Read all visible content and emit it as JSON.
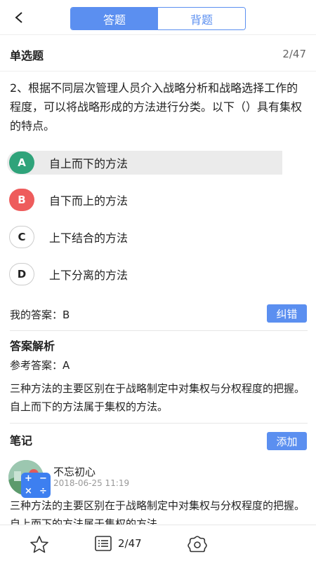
{
  "header": {
    "back_icon": "chevron-left-icon",
    "tabs": [
      {
        "label": "答题",
        "active": true
      },
      {
        "label": "背题",
        "active": false
      }
    ],
    "accent_color": "#5b8ff0"
  },
  "question_type": {
    "title": "单选题",
    "progress": "2/47"
  },
  "question": {
    "text": "2、根据不同层次管理人员介入战略分析和战略选择工作的程度，可以将战略形成的方法进行分类。以下（）具有集权的特点。"
  },
  "options": [
    {
      "letter": "A",
      "text": "自上而下的方法",
      "state": "correct"
    },
    {
      "letter": "B",
      "text": "自下而上的方法",
      "state": "wrong"
    },
    {
      "letter": "C",
      "text": "上下结合的方法",
      "state": "plain"
    },
    {
      "letter": "D",
      "text": "上下分离的方法",
      "state": "plain"
    }
  ],
  "my_answer": {
    "text": "我的答案：B",
    "report_button": "纠错"
  },
  "analysis": {
    "title": "答案解析",
    "reference": "参考答案：A",
    "explanation": "三种方法的主要区别在于战略制定中对集权与分权程度的把握。自上而下的方法属于集权的方法。"
  },
  "notes": {
    "title": "笔记",
    "add_button": "添加",
    "item": {
      "author": "不忘初心",
      "time": "2018-06-25 11:19",
      "content": "三种方法的主要区别在于战略制定中对集权与分权程度的把握。自上而下的方法属于集权的方法。"
    },
    "calculator_glyphs": [
      "+",
      "−",
      "×",
      "÷"
    ]
  },
  "bottom_bar": {
    "favorite_icon": "star-icon",
    "list_icon": "answer-sheet-icon",
    "page": "2/47",
    "settings_icon": "settings-icon"
  },
  "colors": {
    "correct": "#2fa37a",
    "wrong": "#ee5c5c"
  }
}
